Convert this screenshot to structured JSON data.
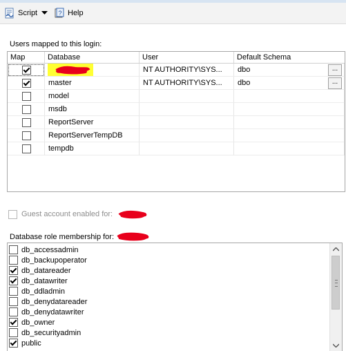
{
  "toolbar": {
    "script_label": "Script",
    "help_label": "Help",
    "script_icon": "script-icon",
    "help_icon": "help-icon"
  },
  "users_section": {
    "label": "Users mapped to this login:",
    "headers": {
      "map": "Map",
      "database": "Database",
      "user": "User",
      "schema": "Default Schema"
    },
    "rows": [
      {
        "checked": true,
        "database": "",
        "user": "NT AUTHORITY\\SYS...",
        "schema": "dbo",
        "has_button": true,
        "selected": true
      },
      {
        "checked": true,
        "database": "master",
        "user": "NT AUTHORITY\\SYS...",
        "schema": "dbo",
        "has_button": true,
        "selected": false
      },
      {
        "checked": false,
        "database": "model",
        "user": "",
        "schema": "",
        "has_button": false,
        "selected": false
      },
      {
        "checked": false,
        "database": "msdb",
        "user": "",
        "schema": "",
        "has_button": false,
        "selected": false
      },
      {
        "checked": false,
        "database": "ReportServer",
        "user": "",
        "schema": "",
        "has_button": false,
        "selected": false
      },
      {
        "checked": false,
        "database": "ReportServerTempDB",
        "user": "",
        "schema": "",
        "has_button": false,
        "selected": false
      },
      {
        "checked": false,
        "database": "tempdb",
        "user": "",
        "schema": "",
        "has_button": false,
        "selected": false
      }
    ],
    "ellipsis_label": "..."
  },
  "guest": {
    "label": "Guest account enabled for:",
    "checked": false,
    "enabled": false
  },
  "roles_section": {
    "label": "Database role membership for:",
    "roles": [
      {
        "name": "db_accessadmin",
        "checked": false
      },
      {
        "name": "db_backupoperator",
        "checked": false
      },
      {
        "name": "db_datareader",
        "checked": true
      },
      {
        "name": "db_datawriter",
        "checked": true
      },
      {
        "name": "db_ddladmin",
        "checked": false
      },
      {
        "name": "db_denydatareader",
        "checked": false
      },
      {
        "name": "db_denydatawriter",
        "checked": false
      },
      {
        "name": "db_owner",
        "checked": true
      },
      {
        "name": "db_securityadmin",
        "checked": false
      },
      {
        "name": "public",
        "checked": true
      }
    ]
  },
  "colors": {
    "highlight": "#ffff33",
    "redaction": "#e8001c"
  }
}
